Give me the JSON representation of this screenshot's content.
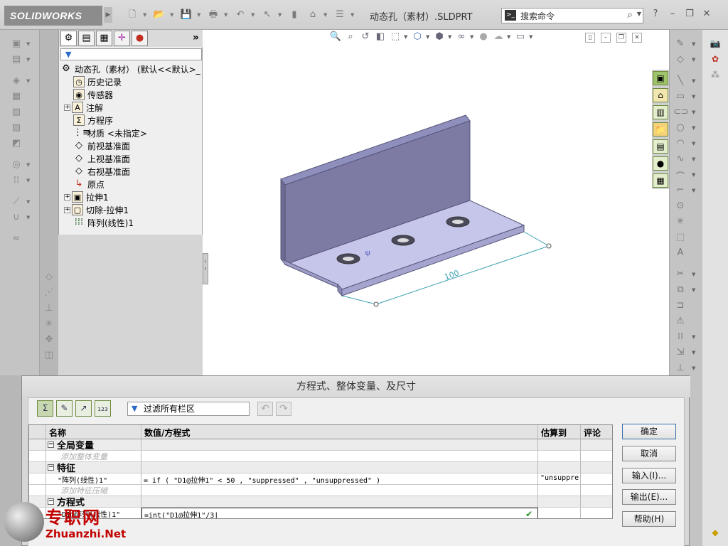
{
  "app": {
    "logo": "SOLIDWORKS",
    "document_title": "动态孔（素材）.SLDPRT",
    "search_placeholder": "搜索命令"
  },
  "feature_manager": {
    "filter": "",
    "tree": [
      {
        "label": "动态孔（素材） (默认<<默认>_",
        "icon": "part-icon",
        "expandable": false
      },
      {
        "label": "历史记录",
        "icon": "history-icon",
        "expandable": false
      },
      {
        "label": "传感器",
        "icon": "sensor-icon",
        "expandable": false
      },
      {
        "label": "注解",
        "icon": "annotation-icon",
        "expandable": true
      },
      {
        "label": "方程序",
        "icon": "equation-icon",
        "expandable": false
      },
      {
        "label": "材质 <未指定>",
        "icon": "material-icon",
        "expandable": false
      },
      {
        "label": "前视基准面",
        "icon": "plane-icon",
        "expandable": false
      },
      {
        "label": "上视基准面",
        "icon": "plane-icon",
        "expandable": false
      },
      {
        "label": "右视基准面",
        "icon": "plane-icon",
        "expandable": false
      },
      {
        "label": "原点",
        "icon": "origin-icon",
        "expandable": false
      },
      {
        "label": "拉伸1",
        "icon": "extrude-icon",
        "expandable": true
      },
      {
        "label": "切除-拉伸1",
        "icon": "cut-extrude-icon",
        "expandable": true
      },
      {
        "label": "阵列(线性)1",
        "icon": "linear-pattern-icon",
        "expandable": false
      }
    ]
  },
  "model": {
    "dimension_label": "100",
    "colors": {
      "part": "#a9a9d8",
      "part_dark": "#7a7aa6",
      "dimension": "#3aa0b0"
    }
  },
  "dialog": {
    "title": "方程式、整体变量、及尺寸",
    "filter_placeholder": "过滤所有栏区",
    "columns": [
      "名称",
      "数值/方程式",
      "估算到",
      "评论"
    ],
    "groups": {
      "global_vars": "全局变量",
      "add_global_var": "添加整体变量",
      "features": "特征",
      "add_feature_suppression": "添加特征压缩",
      "equations": "方程式"
    },
    "rows": {
      "feature_name": "\"阵列(线性)1\"",
      "feature_value": "= if ( \"D1@拉伸1\" < 50 , \"suppressed\" , \"unsuppressed\" )",
      "feature_eval": "\"unsuppre",
      "equation_name": "\"D1@阵列(线性)1\"",
      "equation_value": "=int(\"D1@拉伸1\"/3"
    },
    "buttons": {
      "ok": "确定",
      "cancel": "取消",
      "import": "输入(I)...",
      "export": "输出(E)...",
      "help": "帮助(H)"
    }
  },
  "watermark": {
    "text_cn": "专职网",
    "text_en": "Zhuanzhi.Net"
  }
}
